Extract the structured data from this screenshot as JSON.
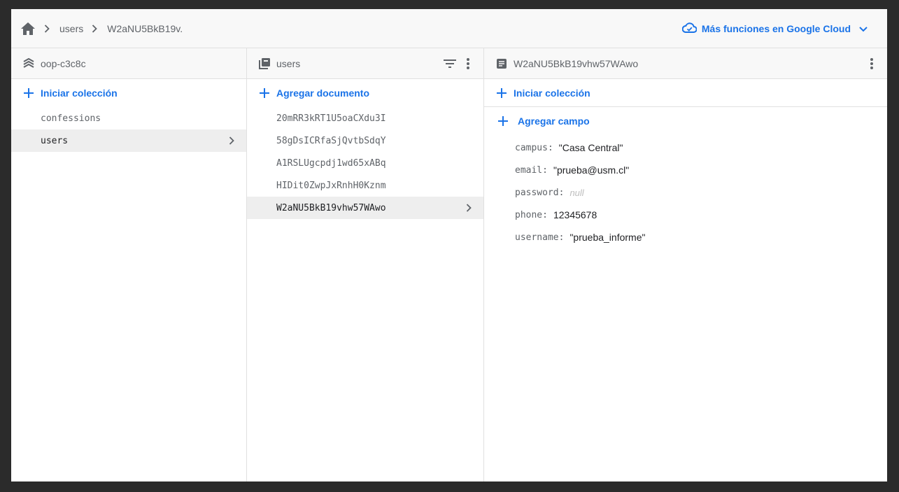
{
  "breadcrumb": {
    "items": [
      "users",
      "W2aNU5BkB19v."
    ]
  },
  "cloud_link": {
    "label": "Más funciones en Google Cloud"
  },
  "column_project": {
    "title": "oop-c3c8c",
    "add_label": "Iniciar colección",
    "items": [
      {
        "label": "confessions",
        "selected": false
      },
      {
        "label": "users",
        "selected": true
      }
    ]
  },
  "column_collection": {
    "title": "users",
    "add_label": "Agregar documento",
    "items": [
      {
        "label": "20mRR3kRT1U5oaCXdu3I",
        "selected": false
      },
      {
        "label": "58gDsICRfaSjQvtbSdqY",
        "selected": false
      },
      {
        "label": "A1RSLUgcpdj1wd65xABq",
        "selected": false
      },
      {
        "label": "HIDit0ZwpJxRnhH0Kznm",
        "selected": false
      },
      {
        "label": "W2aNU5BkB19vhw57WAwo",
        "selected": true
      }
    ]
  },
  "column_document": {
    "title": "W2aNU5BkB19vhw57WAwo",
    "add_collection_label": "Iniciar colección",
    "add_field_label": "Agregar campo",
    "fields": [
      {
        "key": "campus",
        "value": "\"Casa Central\""
      },
      {
        "key": "email",
        "value": "\"prueba@usm.cl\""
      },
      {
        "key": "password",
        "value": "null"
      },
      {
        "key": "phone",
        "value": "12345678"
      },
      {
        "key": "username",
        "value": "\"prueba_informe\""
      }
    ]
  },
  "colors": {
    "accent": "#1a73e8",
    "selected_bg": "#eeeeee",
    "frame_bg": "#2b2b2b"
  }
}
